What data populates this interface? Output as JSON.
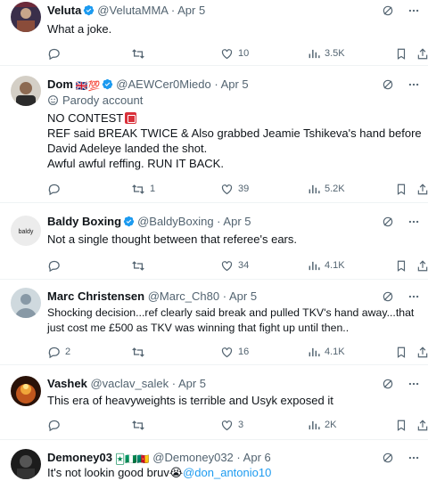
{
  "colors": {
    "verified": "#1d9bf0",
    "muted": "#536471",
    "text": "#0f1419",
    "link": "#1d9bf0"
  },
  "icons": {
    "reply": "reply-icon",
    "retweet": "retweet-icon",
    "like": "heart-icon",
    "views": "views-icon",
    "bookmark": "bookmark-icon",
    "share": "share-icon",
    "grok": "grok-icon",
    "more": "more-icon"
  },
  "tweets": [
    {
      "name": "Veluta",
      "handle": "@VelutaMMA",
      "sep": "·",
      "date": "Apr 5",
      "lines": [
        "What a joke."
      ],
      "reply_count": "",
      "retweet_count": "",
      "like_count": "10",
      "view_count": "3.5K"
    },
    {
      "name": "Dom",
      "name_suffix": "🇬🇧💯",
      "handle": "@AEWCer0Miedo",
      "sep": "·",
      "date": "Apr 5",
      "parody": "Parody account",
      "lines": [
        "NO CONTEST",
        "REF said BREAK TWICE & Also grabbed Jeamie Tshikeva's hand before",
        "David Adeleye landed the shot.",
        "Awful awful reffing. RUN IT BACK."
      ],
      "reply_count": "",
      "retweet_count": "1",
      "like_count": "39",
      "view_count": "5.2K"
    },
    {
      "name": "Baldy Boxing",
      "handle": "@BaldyBoxing",
      "sep": "·",
      "date": "Apr 5",
      "lines": [
        "Not a single thought between that referee's ears."
      ],
      "reply_count": "",
      "retweet_count": "",
      "like_count": "34",
      "view_count": "4.1K"
    },
    {
      "name": "Marc Christensen",
      "handle": "@Marc_Ch80",
      "sep": "·",
      "date": "Apr 5",
      "lines": [
        "Shocking decision...ref clearly said break and pulled TKV's hand away...that",
        "just cost me £500 as TKV was winning that fight up until then.."
      ],
      "reply_count": "2",
      "retweet_count": "",
      "like_count": "16",
      "view_count": "4.1K"
    },
    {
      "name": "Vashek",
      "handle": "@vaclav_salek",
      "sep": "·",
      "date": "Apr 5",
      "lines": [
        "This era of heavyweights is terrible and Usyk exposed it"
      ],
      "reply_count": "",
      "retweet_count": "",
      "like_count": "3",
      "view_count": "2K"
    },
    {
      "name": "Demoney03",
      "name_suffix": "🃏🇳🇬🇨🇲",
      "handle": "@Demoney032",
      "sep": "·",
      "date": "Apr 6",
      "text_prefix": "It's not lookin good bruv😭",
      "mention": "@don_antonio10"
    }
  ]
}
